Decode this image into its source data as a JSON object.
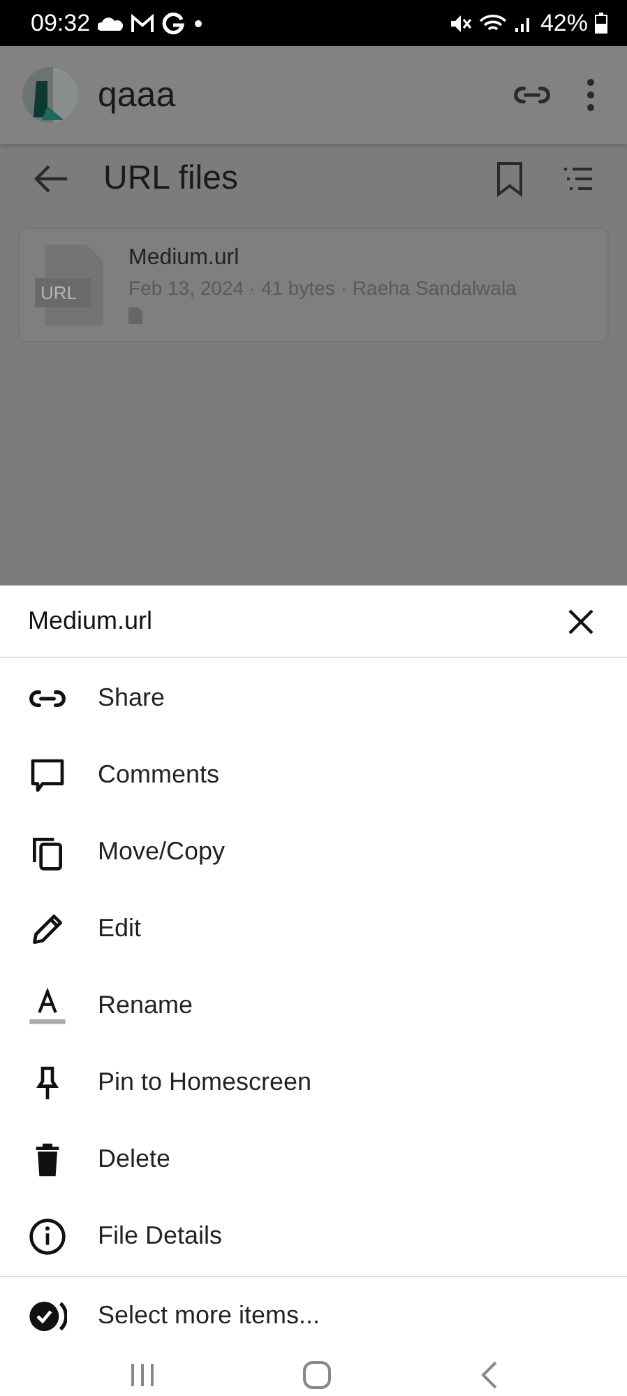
{
  "status_bar": {
    "time": "09:32",
    "battery": "42%"
  },
  "app_bar": {
    "title": "qaaa"
  },
  "toolbar": {
    "title": "URL files"
  },
  "files": [
    {
      "name": "Medium.url",
      "meta": "Feb 13, 2024 · 41 bytes · Raeha Sandalwala",
      "thumb_label": "URL"
    }
  ],
  "sheet": {
    "title": "Medium.url",
    "items": [
      {
        "kind": "share",
        "label": "Share"
      },
      {
        "kind": "comments",
        "label": "Comments"
      },
      {
        "kind": "copy",
        "label": "Move/Copy"
      },
      {
        "kind": "edit",
        "label": "Edit"
      },
      {
        "kind": "rename",
        "label": "Rename"
      },
      {
        "kind": "pin",
        "label": "Pin to Homescreen"
      },
      {
        "kind": "delete",
        "label": "Delete"
      },
      {
        "kind": "info",
        "label": "File Details"
      }
    ],
    "footer_item": {
      "kind": "select",
      "label": "Select more items..."
    }
  }
}
